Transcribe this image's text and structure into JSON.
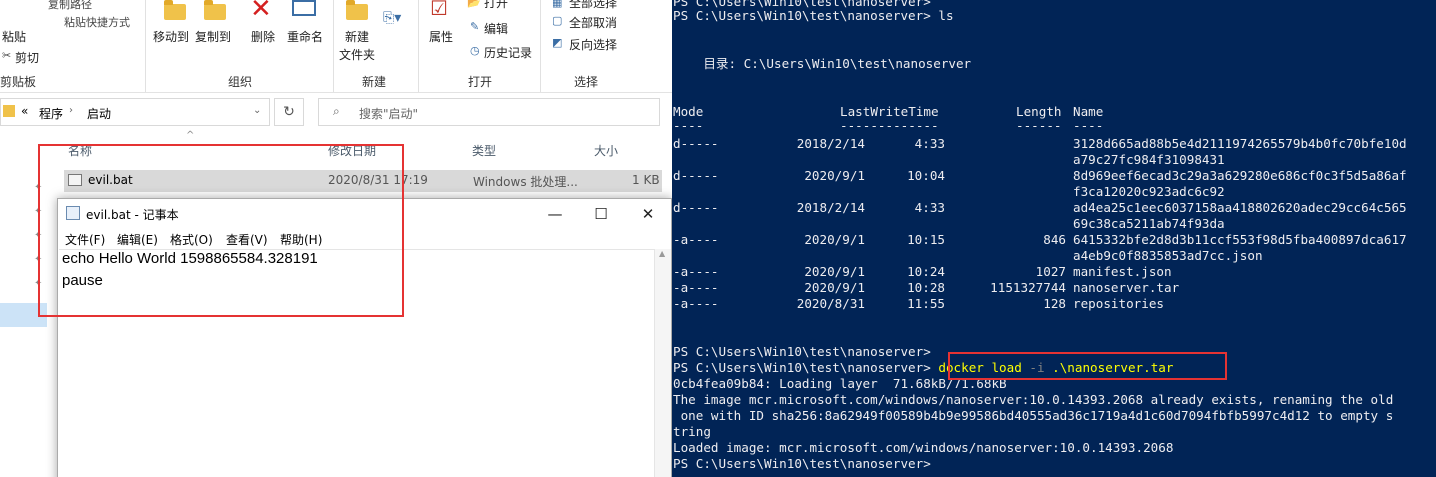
{
  "ribbon": {
    "clipboard": {
      "paste": "粘贴",
      "copy_path": "复制路径",
      "paste_shortcut": "粘贴快捷方式",
      "cut": "剪切",
      "group": "剪贴板"
    },
    "organize": {
      "move_to": "移动到",
      "copy_to": "复制到",
      "delete": "删除",
      "rename": "重命名",
      "group": "组织"
    },
    "new": {
      "new_folder_line1": "新建",
      "new_folder_line2": "文件夹",
      "group": "新建"
    },
    "open": {
      "properties": "属性",
      "open": "打开",
      "edit": "编辑",
      "history": "历史记录",
      "group": "打开"
    },
    "select": {
      "select_all": "全部选择",
      "select_none": "全部取消",
      "invert": "反向选择",
      "group": "选择"
    }
  },
  "address": {
    "prefix": "«",
    "crumbs": [
      "程序",
      "启动"
    ],
    "search_placeholder": "搜索\"启动\""
  },
  "filelist": {
    "columns": [
      "名称",
      "修改日期",
      "类型",
      "大小"
    ],
    "rows": [
      {
        "name": "evil.bat",
        "date": "2020/8/31 17:19",
        "type": "Windows 批处理...",
        "size": "1 KB"
      }
    ]
  },
  "notepad": {
    "title": "evil.bat - 记事本",
    "menu": [
      "文件(F)",
      "编辑(E)",
      "格式(O)",
      "查看(V)",
      "帮助(H)"
    ],
    "lines": [
      "echo Hello World 1598865584.328191",
      "pause"
    ]
  },
  "powershell": {
    "prompt_top": "PS C:\\Users\\Win10\\test\\nanoserver>",
    "prompt_ls": "PS C:\\Users\\Win10\\test\\nanoserver> ls",
    "dir_label": "    目录: C:\\Users\\Win10\\test\\nanoserver",
    "headers": {
      "mode": "Mode",
      "lwt": "LastWriteTime",
      "length": "Length",
      "name": "Name"
    },
    "underlines": {
      "mode": "----",
      "lwt": "-------------",
      "length": "------",
      "name": "----"
    },
    "entries": [
      {
        "mode": "d-----",
        "date": "2018/2/14",
        "time": "4:33",
        "length": "",
        "name": "3128d665ad88b5e4d2111974265579b4b0fc70bfe10d",
        "name2": "a79c27fc984f31098431"
      },
      {
        "mode": "d-----",
        "date": "2020/9/1",
        "time": "10:04",
        "length": "",
        "name": "8d969eef6ecad3c29a3a629280e686cf0c3f5d5a86af",
        "name2": "f3ca12020c923adc6c92"
      },
      {
        "mode": "d-----",
        "date": "2018/2/14",
        "time": "4:33",
        "length": "",
        "name": "ad4ea25c1eec6037158aa418802620adec29cc64c565",
        "name2": "69c38ca5211ab74f93da"
      },
      {
        "mode": "-a----",
        "date": "2020/9/1",
        "time": "10:15",
        "length": "846",
        "name": "6415332bfe2d8d3b11ccf553f98d5fba400897dca617",
        "name2": "a4eb9c0f8835853ad7cc.json"
      },
      {
        "mode": "-a----",
        "date": "2020/9/1",
        "time": "10:24",
        "length": "1027",
        "name": "manifest.json",
        "name2": ""
      },
      {
        "mode": "-a----",
        "date": "2020/9/1",
        "time": "10:28",
        "length": "1151327744",
        "name": "nanoserver.tar",
        "name2": ""
      },
      {
        "mode": "-a----",
        "date": "2020/8/31",
        "time": "11:55",
        "length": "128",
        "name": "repositories",
        "name2": ""
      }
    ],
    "prompt_blank": "PS C:\\Users\\Win10\\test\\nanoserver>",
    "prompt_cmd_prefix": "PS C:\\Users\\Win10\\test\\nanoserver> ",
    "cmd": "docker",
    "cmd_arg1": " load ",
    "cmd_param": "-i",
    "cmd_arg2": " .\\nanoserver.tar",
    "output": [
      "0cb4fea09b84: Loading layer  71.68kB/71.68kB",
      "The image mcr.microsoft.com/windows/nanoserver:10.0.14393.2068 already exists, renaming the old",
      " one with ID sha256:8a62949f00589b4b9e99586bd40555ad36c1719a4d1c60d7094fbfb5997c4d12 to empty s",
      "tring",
      "Loaded image: mcr.microsoft.com/windows/nanoserver:10.0.14393.2068",
      "PS C:\\Users\\Win10\\test\\nanoserver>"
    ]
  }
}
